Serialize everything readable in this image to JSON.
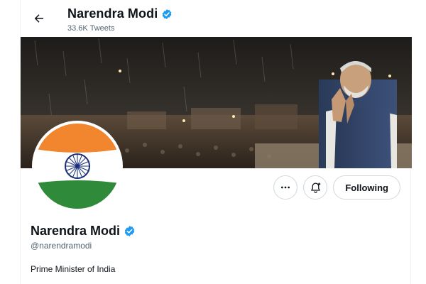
{
  "header": {
    "back_icon": "arrow-left-icon",
    "name": "Narendra Modi",
    "tweet_count": "33.6K Tweets",
    "verified_icon": "verified-badge-icon"
  },
  "banner": {
    "description_icon": "banner-photo"
  },
  "profile": {
    "avatar_icon": "india-flag-avatar",
    "name": "Narendra Modi",
    "handle": "@narendramodi",
    "bio": "Prime Minister of India"
  },
  "actions": {
    "more_icon": "more-dots-icon",
    "notify_icon": "bell-plus-icon",
    "follow_label": "Following"
  },
  "colors": {
    "verified": "#1d9bf0",
    "secondary_text": "#536471",
    "saffron": "#f2862e",
    "green": "#2f8a3a",
    "chakra": "#1a2f7a"
  }
}
